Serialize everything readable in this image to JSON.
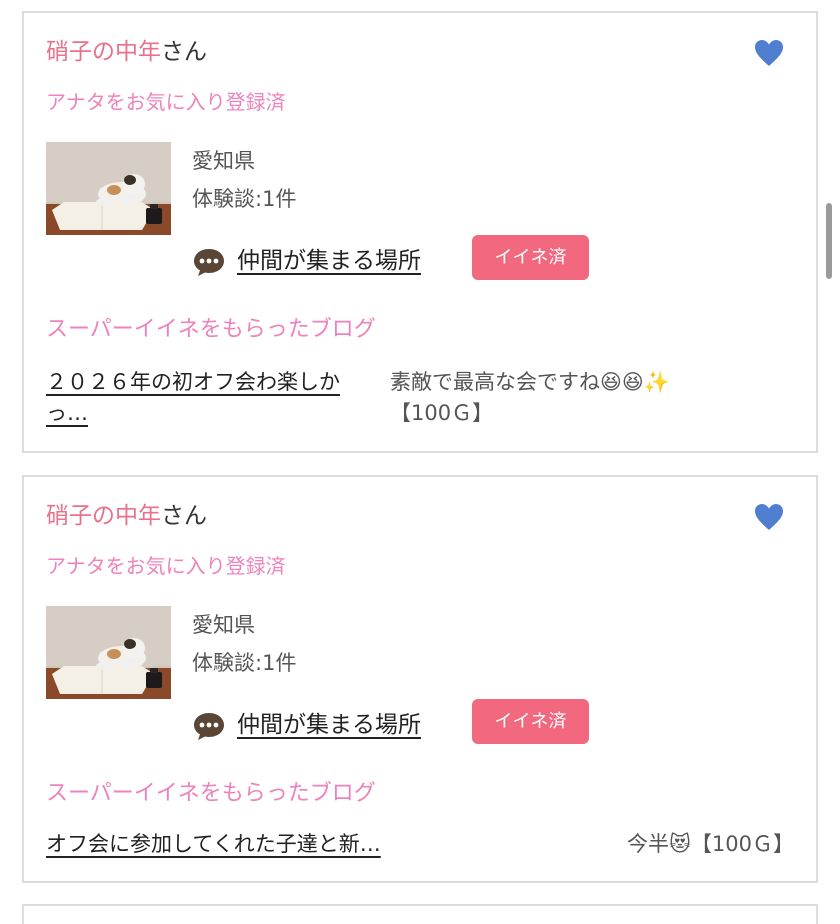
{
  "cards": [
    {
      "user_name": "硝子の中年",
      "user_suffix": "さん",
      "favorite_status": "アナタをお気に入り登録済",
      "prefecture": "愛知県",
      "experience_label": "体験談:",
      "experience_count": "1件",
      "community_link": "仲間が集まる場所",
      "like_badge": "イイネ済",
      "section_heading": "スーパーイイネをもらったブログ",
      "blog_title": "２０２６年の初オフ会わ楽しかっ…",
      "blog_comment": "素敵で最高な会ですね😆😆✨",
      "blog_reward": "【100Ｇ】"
    },
    {
      "user_name": "硝子の中年",
      "user_suffix": "さん",
      "favorite_status": "アナタをお気に入り登録済",
      "prefecture": "愛知県",
      "experience_label": "体験談:",
      "experience_count": "1件",
      "community_link": "仲間が集まる場所",
      "like_badge": "イイネ済",
      "section_heading": "スーパーイイネをもらったブログ",
      "blog_title": "オフ会に参加してくれた子達と新…",
      "blog_comment": "今半😻",
      "blog_reward": "【100Ｇ】"
    }
  ],
  "colors": {
    "accent_pink": "#e8728a",
    "heading_pink": "#ee82bc",
    "badge_pink": "#f2687f",
    "heart_blue": "#4f7fce",
    "card_border": "#dcdcdc"
  },
  "icons": {
    "favorite": "heart-icon",
    "community": "speech-bubble-icon",
    "avatar": "cat-on-notebook-photo"
  }
}
